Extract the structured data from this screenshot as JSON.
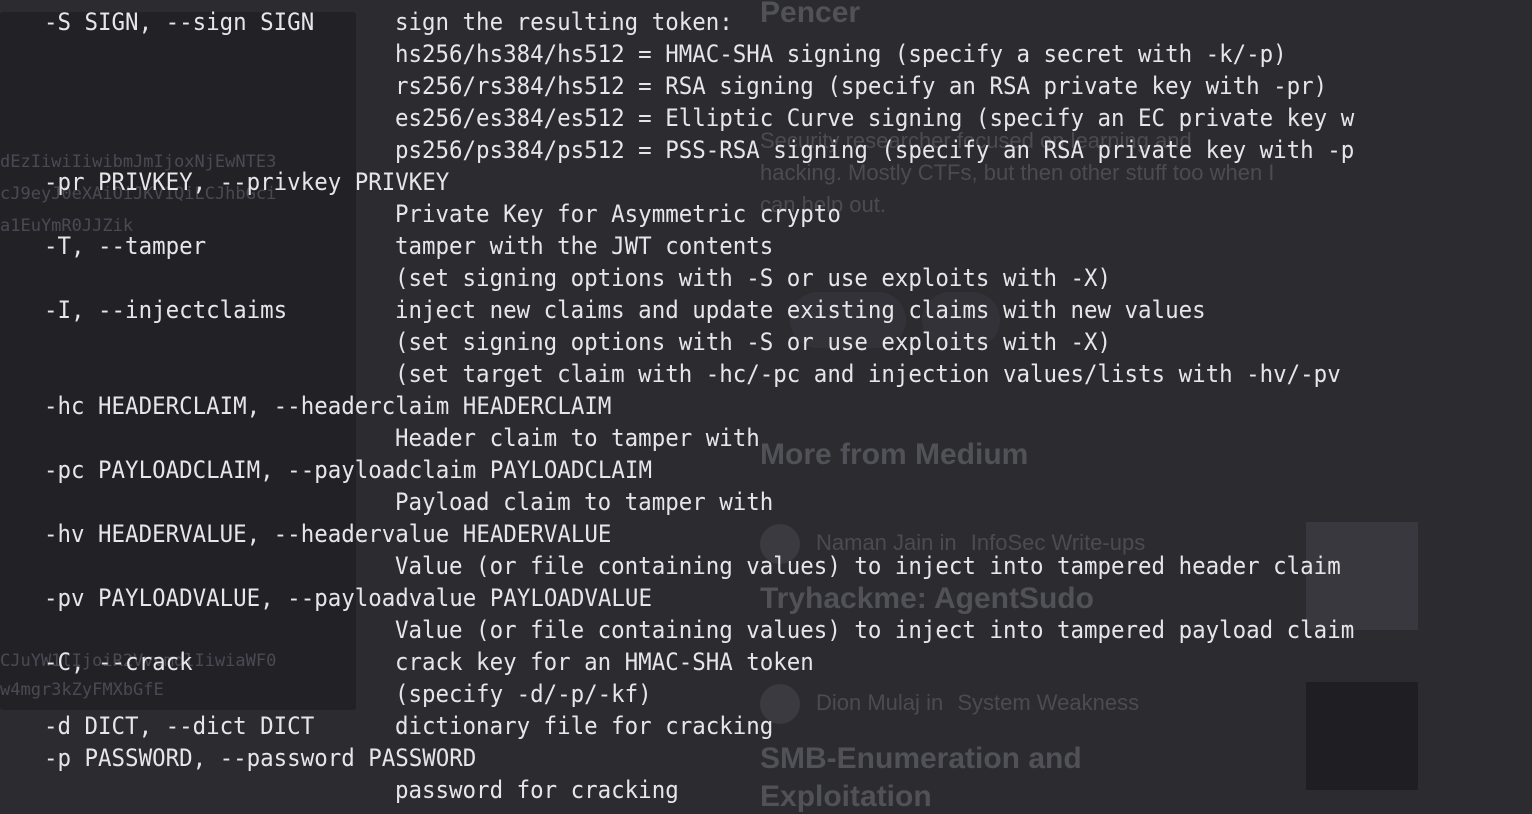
{
  "terminal": {
    "lines": [
      {
        "opt": "-S SIGN, --sign SIGN",
        "desc": "sign the resulting token:"
      },
      {
        "opt": "",
        "desc": "hs256/hs384/hs512 = HMAC-SHA signing (specify a secret with -k/-p)"
      },
      {
        "opt": "",
        "desc": "rs256/rs384/hs512 = RSA signing (specify an RSA private key with -pr)"
      },
      {
        "opt": "",
        "desc": "es256/es384/es512 = Elliptic Curve signing (specify an EC private key w"
      },
      {
        "opt": "",
        "desc": "ps256/ps384/ps512 = PSS-RSA signing (specify an RSA private key with -p"
      },
      {
        "opt": "-pr PRIVKEY, --privkey PRIVKEY",
        "desc": ""
      },
      {
        "opt": "",
        "desc": "Private Key for Asymmetric crypto"
      },
      {
        "opt": "-T, --tamper",
        "desc": "tamper with the JWT contents"
      },
      {
        "opt": "",
        "desc": "(set signing options with -S or use exploits with -X)"
      },
      {
        "opt": "-I, --injectclaims",
        "desc": "inject new claims and update existing claims with new values"
      },
      {
        "opt": "",
        "desc": "(set signing options with -S or use exploits with -X)"
      },
      {
        "opt": "",
        "desc": "(set target claim with -hc/-pc and injection values/lists with -hv/-pv"
      },
      {
        "opt": "-hc HEADERCLAIM, --headerclaim HEADERCLAIM",
        "desc": ""
      },
      {
        "opt": "",
        "desc": "Header claim to tamper with"
      },
      {
        "opt": "-pc PAYLOADCLAIM, --payloadclaim PAYLOADCLAIM",
        "desc": ""
      },
      {
        "opt": "",
        "desc": "Payload claim to tamper with"
      },
      {
        "opt": "-hv HEADERVALUE, --headervalue HEADERVALUE",
        "desc": ""
      },
      {
        "opt": "",
        "desc": "Value (or file containing values) to inject into tampered header claim"
      },
      {
        "opt": "-pv PAYLOADVALUE, --payloadvalue PAYLOADVALUE",
        "desc": ""
      },
      {
        "opt": "",
        "desc": "Value (or file containing values) to inject into tampered payload claim"
      },
      {
        "opt": "-C, --crack",
        "desc": "crack key for an HMAC-SHA token"
      },
      {
        "opt": "",
        "desc": "(specify -d/-p/-kf)"
      },
      {
        "opt": "-d DICT, --dict DICT",
        "desc": "dictionary file for cracking"
      },
      {
        "opt": "-p PASSWORD, --password PASSWORD",
        "desc": ""
      },
      {
        "opt": "",
        "desc": "password for cracking"
      }
    ]
  },
  "background": {
    "code_lines": [
      "dEzIiwiIiwibmJmIjoxNjEwNTE3",
      "cJ9eyJ0eXAiOiJKV1QiLCJhbGci",
      "a1EuYmR0JJZik",
      "CJuYW1lIjoiR2VvcmdlIiwiaWF0",
      "w4mgr3kZyFMXbGfE"
    ],
    "author_name": "Pencer",
    "bio_line_1": "Security researcher focused on learning and",
    "bio_line_2": "hacking. Mostly CTFs, but then other stuff too when I",
    "bio_line_3": "can help out.",
    "section_title": "More from Medium",
    "article_1": {
      "author": "Naman Jain",
      "in": "in",
      "publication": "InfoSec Write-ups",
      "title": "Tryhackme: AgentSudo"
    },
    "article_2": {
      "author": "Dion Mulaj",
      "in": "in",
      "publication": "System Weakness",
      "title_line_1": "SMB-Enumeration and",
      "title_line_2": "Exploitation"
    }
  }
}
